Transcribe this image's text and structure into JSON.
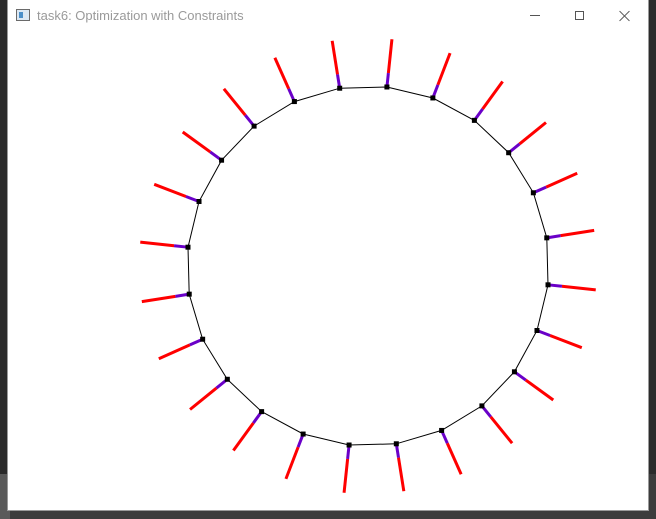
{
  "window": {
    "title": "task6: Optimization with Constraints",
    "icon": "app-window-icon",
    "controls": {
      "minimize": "minimize-icon",
      "maximize": "maximize-icon",
      "close": "close-icon"
    }
  },
  "simulation": {
    "node_count": 24,
    "colors": {
      "ring_edge": "#000000",
      "node": "#000000",
      "force_outer": "#ff0000",
      "force_inner": "#6a00c8",
      "background": "#ffffff"
    }
  }
}
